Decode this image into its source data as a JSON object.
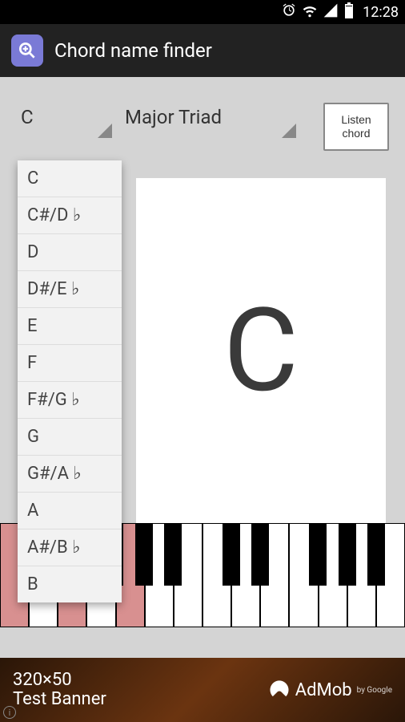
{
  "status": {
    "time": "12:28"
  },
  "app": {
    "title": "Chord name finder"
  },
  "controls": {
    "rootSelected": "C",
    "chordTypeSelected": "Major Triad",
    "listenLine1": "Listen",
    "listenLine2": "chord"
  },
  "display": {
    "chordName": "C"
  },
  "dropdown": {
    "items": [
      "C",
      "C#/D ♭",
      "D",
      "D#/E ♭",
      "E",
      "F",
      "F#/G ♭",
      "G",
      "G#/A ♭",
      "A",
      "A#/B ♭",
      "B"
    ]
  },
  "piano": {
    "whiteKeys": 14,
    "activeWhiteIndices": [
      0,
      2,
      4
    ],
    "blackKeyPositions": [
      25,
      61,
      132,
      169,
      205,
      278,
      314,
      386,
      423,
      459
    ]
  },
  "ad": {
    "size": "320×50",
    "label": "Test Banner",
    "brand": "AdMob",
    "by": "by Google"
  }
}
